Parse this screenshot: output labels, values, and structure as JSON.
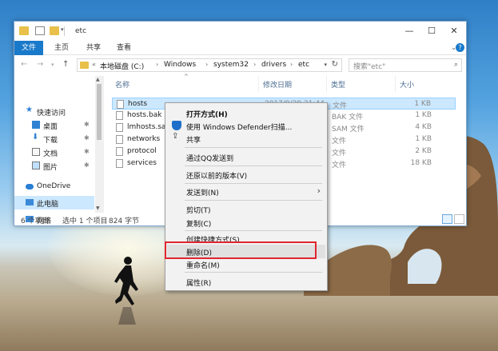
{
  "window": {
    "title": "etc",
    "controls": {
      "minimize": "—",
      "maximize": "☐",
      "close": "✕"
    }
  },
  "ribbon": {
    "tabs": [
      "文件",
      "主页",
      "共享",
      "查看"
    ],
    "help": "?"
  },
  "address": {
    "breadcrumb": [
      "本地磁盘 (C:)",
      "Windows",
      "system32",
      "drivers",
      "etc"
    ],
    "lead": "«",
    "separator": "›",
    "search_placeholder": "搜索\"etc\""
  },
  "nav": {
    "items": [
      {
        "label": "快速访问",
        "icon": "star-icon",
        "pinned": false
      },
      {
        "label": "桌面",
        "icon": "desktop-icon",
        "pinned": true
      },
      {
        "label": "下载",
        "icon": "download-icon",
        "pinned": true
      },
      {
        "label": "文档",
        "icon": "document-icon",
        "pinned": true
      },
      {
        "label": "图片",
        "icon": "picture-icon",
        "pinned": true
      },
      {
        "label": "OneDrive",
        "icon": "cloud-icon",
        "pinned": false
      },
      {
        "label": "此电脑",
        "icon": "computer-icon",
        "pinned": false
      },
      {
        "label": "网络",
        "icon": "network-icon",
        "pinned": false
      }
    ],
    "pin_glyph": "📌"
  },
  "columns": {
    "name": "名称",
    "date": "修改日期",
    "type": "类型",
    "size": "大小"
  },
  "files": [
    {
      "name": "hosts",
      "date": "2017/9/29 21:44",
      "type": "文件",
      "size": "1 KB"
    },
    {
      "name": "hosts.bak",
      "date": "",
      "type": "BAK 文件",
      "size": "1 KB"
    },
    {
      "name": "lmhosts.sam",
      "date": "",
      "type": "SAM 文件",
      "size": "4 KB"
    },
    {
      "name": "networks",
      "date": "",
      "type": "文件",
      "size": "1 KB"
    },
    {
      "name": "protocol",
      "date": "",
      "type": "文件",
      "size": "2 KB"
    },
    {
      "name": "services",
      "date": "",
      "type": "文件",
      "size": "18 KB"
    }
  ],
  "status": {
    "count": "6 个项目",
    "selected": "选中 1 个项目",
    "size": "824 字节"
  },
  "context_menu": {
    "open_with": "打开方式(H)",
    "defender": "使用 Windows Defender扫描...",
    "share": "共享",
    "qq": "通过QQ发送到",
    "restore": "还原以前的版本(V)",
    "send_to": "发送到(N)",
    "cut": "剪切(T)",
    "copy": "复制(C)",
    "shortcut": "创建快捷方式(S)",
    "delete": "删除(D)",
    "rename": "重命名(M)",
    "properties": "属性(R)",
    "submenu_arrow": "›"
  },
  "colors": {
    "accent": "#1979ca",
    "selection": "#cce8ff",
    "highlight_box": "#e0252f"
  }
}
